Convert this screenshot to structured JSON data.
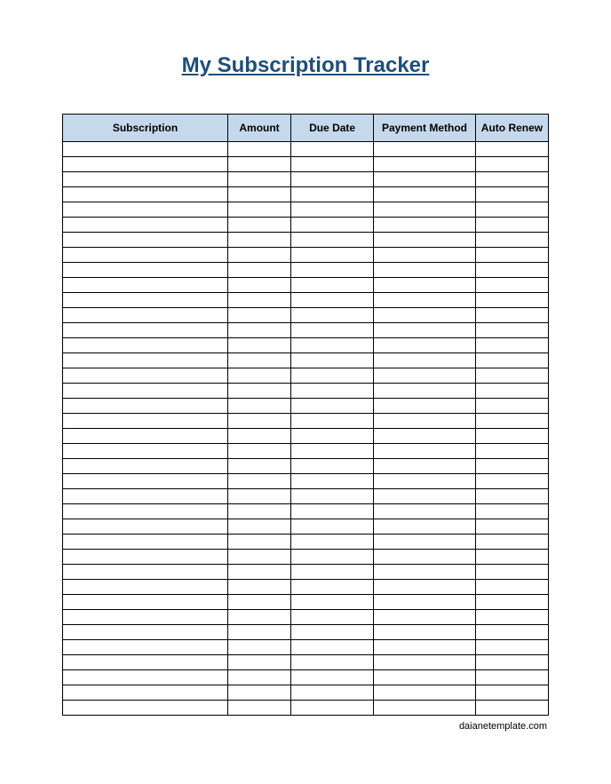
{
  "title": "My Subscription Tracker",
  "columns": [
    "Subscription",
    "Amount",
    "Due Date",
    "Payment Method",
    "Auto Renew"
  ],
  "row_count": 38,
  "footer": "daianetemplate.com"
}
